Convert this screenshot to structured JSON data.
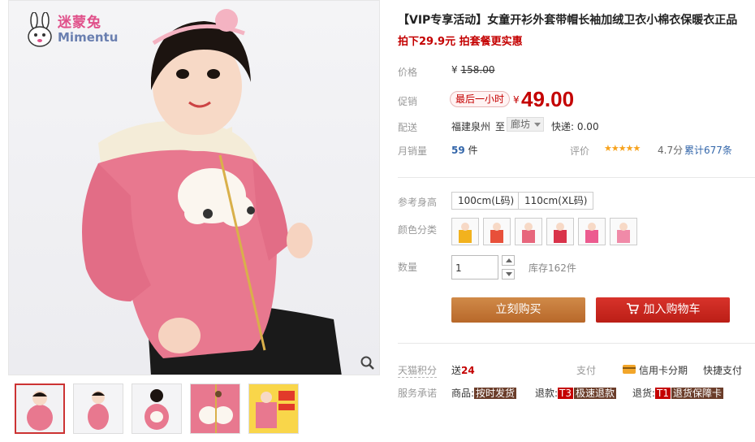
{
  "brand": {
    "name_cn": "迷蒙兔",
    "name_en": "Mimentu"
  },
  "product": {
    "title": "【VIP专享活动】女童开衫外套带帽长袖加绒卫衣小棉衣保暖衣正品",
    "subtitle": "拍下29.9元 拍套餐更实惠"
  },
  "price": {
    "label": "价格",
    "currency": "¥",
    "original": "158.00",
    "promo_label": "促销",
    "promo_tag": "最后一小时",
    "current": "49.00"
  },
  "shipping": {
    "label": "配送",
    "from": "福建泉州",
    "to_word": "至",
    "destination": "廊坊",
    "fee": "快递: 0.00"
  },
  "sales": {
    "label": "月销量",
    "count": "59",
    "unit": "件",
    "rating_label": "评价",
    "stars": "★★★★★",
    "score": "4.7分",
    "reviews": "累计677条"
  },
  "options": {
    "size_label": "参考身高",
    "sizes": [
      "100cm(L码)",
      "110cm(XL码)"
    ],
    "color_label": "颜色分类",
    "color_count": 6,
    "qty_label": "数量",
    "qty_value": "1",
    "stock": "库存162件"
  },
  "actions": {
    "buy": "立刻购买",
    "cart": "加入购物车"
  },
  "extras": {
    "points_label": "天猫积分",
    "points_prefix": "送",
    "points_value": "24",
    "pay_label": "支付",
    "pay_credit": "信用卡分期",
    "pay_quick": "快捷支付",
    "service_label": "服务承诺",
    "service_goods_prefix": "商品:",
    "service_goods_tag": "按时发货",
    "service_refund_prefix": "退款:",
    "service_refund_code": "T3",
    "service_refund_tag": "极速退款",
    "service_return_prefix": "退货:",
    "service_return_code": "T1",
    "service_return_tag": "退货保障卡"
  },
  "thumbnails_count": 5,
  "colors": {
    "price_red": "#c40000",
    "buy_orange": "#c47a3a",
    "cart_red": "#c8261e",
    "link_blue": "#3366aa",
    "star_gold": "#f7a21c"
  }
}
